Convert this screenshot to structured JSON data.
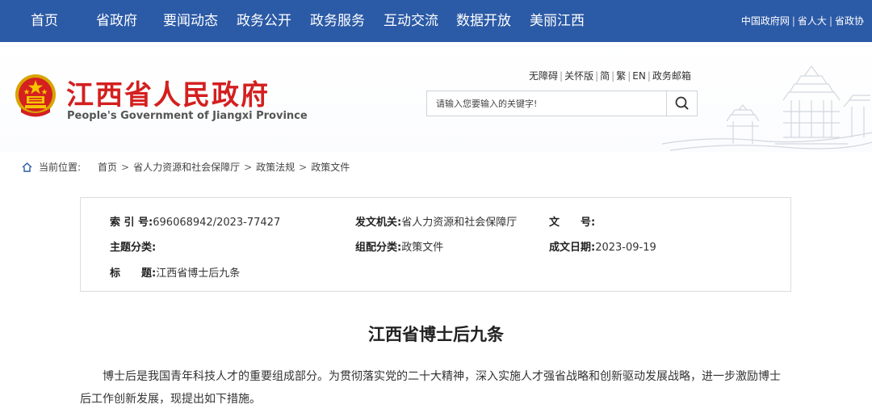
{
  "nav": {
    "items": [
      "首页",
      "省政府",
      "要闻动态",
      "政务公开",
      "政务服务",
      "互动交流",
      "数据开放",
      "美丽江西"
    ],
    "links": [
      "中国政府网",
      "省人大",
      "省政协"
    ]
  },
  "header": {
    "title": "江西省人民政府",
    "subtitle": "People's Government of Jiangxi Province",
    "util_links": [
      "无障碍",
      "关怀版",
      "简",
      "繁",
      "EN",
      "政务邮箱"
    ],
    "search_placeholder": "请输入您要输入的关键字!"
  },
  "breadcrumb": {
    "label": "当前位置:",
    "items": [
      "首页",
      "省人力资源和社会保障厅",
      "政策法规",
      "政策文件"
    ]
  },
  "info": {
    "index_label": "索 引 号:",
    "index_value": "696068942/2023-77427",
    "issuer_label": "发文机关:",
    "issuer_value": "省人力资源和社会保障厅",
    "docno_label": "文　　号:",
    "docno_value": "",
    "topic_label": "主题分类:",
    "topic_value": "",
    "category_label": "组配分类:",
    "category_value": "政策文件",
    "date_label": "成文日期:",
    "date_value": "2023-09-19",
    "title_label": "标　　题:",
    "title_value": "江西省博士后九条"
  },
  "article": {
    "title": "江西省博士后九条",
    "paragraph": "博士后是我国青年科技人才的重要组成部分。为贯彻落实党的二十大精神，深入实施人才强省战略和创新驱动发展战略，进一步激励博士后工作创新发展，现提出如下措施。"
  },
  "colors": {
    "nav_bg": "#2b5aa6",
    "title_red": "#d41f1f"
  }
}
